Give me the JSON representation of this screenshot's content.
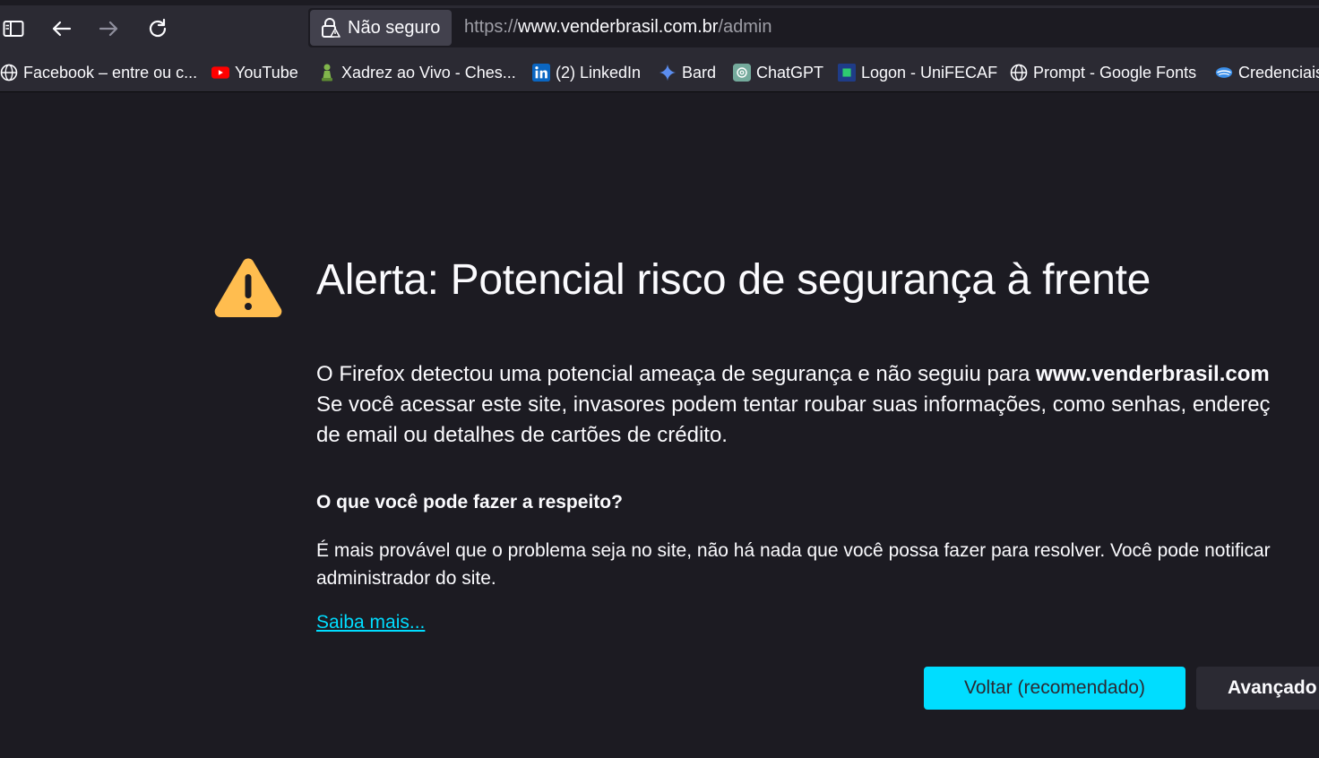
{
  "toolbar": {
    "identity_label": "Não seguro",
    "url": {
      "scheme": "https://",
      "host": "www.venderbrasil.com.br",
      "path": "/admin"
    }
  },
  "bookmarks": [
    {
      "label": "Facebook – entre ou c...",
      "icon": "globe-icon"
    },
    {
      "label": "YouTube",
      "icon": "youtube-icon"
    },
    {
      "label": "Xadrez ao Vivo - Ches...",
      "icon": "chess-pawn-icon"
    },
    {
      "label": "(2) LinkedIn",
      "icon": "linkedin-icon"
    },
    {
      "label": "Bard",
      "icon": "sparkle-icon"
    },
    {
      "label": "ChatGPT",
      "icon": "chatgpt-icon"
    },
    {
      "label": "Logon - UniFECAF",
      "icon": "unifecaf-icon"
    },
    {
      "label": "Prompt - Google Fonts",
      "icon": "globe-icon"
    },
    {
      "label": "Credenciais",
      "icon": "credenciais-icon"
    }
  ],
  "error": {
    "title": "Alerta: Potencial risco de segurança à frente",
    "intro_line1_pre": "O Firefox detectou uma potencial ameaça de segurança e não seguiu para ",
    "intro_line1_host": "www.venderbrasil.com",
    "intro_line2": "Se você acessar este site, invasores podem tentar roubar suas informações, como senhas, endereç",
    "intro_line3": "de email ou detalhes de cartões de crédito.",
    "what_heading": "O que você pode fazer a respeito?",
    "advice_line1": "É mais provável que o problema seja no site, não há nada que você possa fazer para resolver. Você pode notificar",
    "advice_line2": "administrador do site.",
    "learn_more": "Saiba mais...",
    "back_button": "Voltar (recomendado)",
    "advanced_button": "Avançado"
  },
  "colors": {
    "accent": "#00ddff",
    "warning": "#ffbd4f",
    "background": "#1c1b22",
    "chrome": "#2b2a33"
  }
}
